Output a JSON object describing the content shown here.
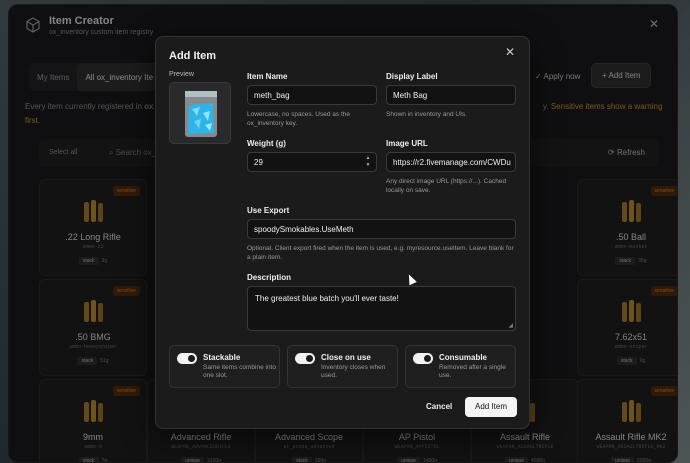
{
  "app": {
    "title": "Item Creator",
    "subtitle": "ox_inventory custom item registry",
    "tabs": [
      {
        "label": "My Items"
      },
      {
        "label": "All ox_inventory Ite"
      }
    ],
    "apply_label": "Apply now",
    "add_item_label": "Add Item",
    "notice_start": "Every item currently registered in ",
    "notice_bold": "ox_",
    "notice_end": "y.",
    "notice_warn": "Sensitive items show a warning",
    "notice_warn_2": "first.",
    "select_all": "Select all",
    "search_placeholder": "Search ox_inven",
    "refresh_label": "Refresh",
    "cards": [
      {
        "name": ".22 Long Rifle",
        "code": "ammo-22",
        "chip": "stack",
        "weight": "3g",
        "badge": "sensitive"
      },
      {
        "name": ".50 Ball",
        "code": "ammo-musket",
        "chip": "stack",
        "weight": "38g",
        "badge": "sensitive"
      },
      {
        "name": ".50 BMG",
        "code": "ammo-heavysniper",
        "chip": "stack",
        "weight": "51g",
        "badge": "sensitive"
      },
      {
        "name": "7.62x51",
        "code": "ammo-sniper",
        "chip": "stack",
        "weight": "9g",
        "badge": "sensitive"
      },
      {
        "name": "9mm",
        "code": "ammo-9",
        "chip": "stack",
        "weight": "7g",
        "badge": "sensitive"
      },
      {
        "name": "Advanced Rifle",
        "code": "WEAPON_ADVANCEDRIFLE",
        "chip": "unique",
        "weight": "3100g",
        "badge": ""
      },
      {
        "name": "Advanced Scope",
        "code": "at_scope_advanced",
        "chip": "stack",
        "weight": "280g",
        "badge": ""
      },
      {
        "name": "AP Pistol",
        "code": "WEAPON_APPISTOL",
        "chip": "unique",
        "weight": "1400g",
        "badge": ""
      },
      {
        "name": "Assault Rifle",
        "code": "WEAPON_ASSAULTRIFLE",
        "chip": "unique",
        "weight": "4500g",
        "badge": ""
      },
      {
        "name": "Assault Rifle MK2",
        "code": "WEAPON_ASSAULTRIFLE_MK2",
        "chip": "unique",
        "weight": "2950g",
        "badge": "sensitive"
      }
    ]
  },
  "modal": {
    "title": "Add Item",
    "preview_label": "Preview",
    "item_name": {
      "label": "Item Name",
      "value": "meth_bag",
      "help": "Lowercase, no spaces. Used as the ox_inventory key."
    },
    "display_label": {
      "label": "Display Label",
      "value": "Meth Bag",
      "help": "Shown in inventory and UIs."
    },
    "weight": {
      "label": "Weight (g)",
      "value": "29"
    },
    "image_url": {
      "label": "Image URL",
      "value": "https://r2.fivemanage.com/CWDu",
      "help": "Any direct image URL (https://...). Cached locally on save."
    },
    "use_export": {
      "label": "Use Export",
      "value": "spoodySmokables.UseMeth",
      "help": "Optional. Client export fired when the item is used, e.g. myresource.useItem. Leave blank for a plain item."
    },
    "description": {
      "label": "Description",
      "value": "The greatest blue batch you'll ever taste!"
    },
    "toggles": [
      {
        "title": "Stackable",
        "desc": "Same items combine into one slot."
      },
      {
        "title": "Close on use",
        "desc": "Inventory closes when used."
      },
      {
        "title": "Consumable",
        "desc": "Removed after a single use."
      }
    ],
    "cancel_label": "Cancel",
    "submit_label": "Add Item"
  }
}
